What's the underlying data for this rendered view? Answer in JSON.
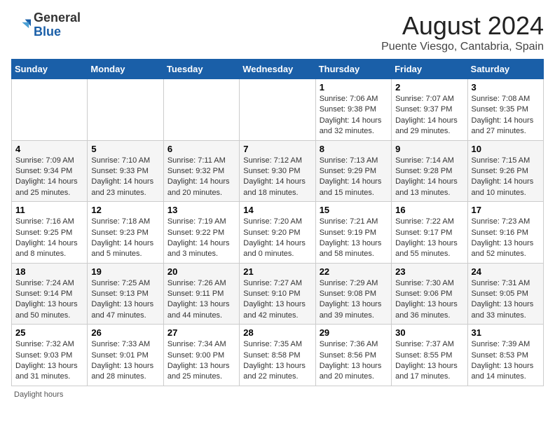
{
  "logo": {
    "general": "General",
    "blue": "Blue"
  },
  "header": {
    "title": "August 2024",
    "subtitle": "Puente Viesgo, Cantabria, Spain"
  },
  "weekdays": [
    "Sunday",
    "Monday",
    "Tuesday",
    "Wednesday",
    "Thursday",
    "Friday",
    "Saturday"
  ],
  "weeks": [
    [
      {
        "day": "",
        "info": ""
      },
      {
        "day": "",
        "info": ""
      },
      {
        "day": "",
        "info": ""
      },
      {
        "day": "",
        "info": ""
      },
      {
        "day": "1",
        "info": "Sunrise: 7:06 AM\nSunset: 9:38 PM\nDaylight: 14 hours and 32 minutes."
      },
      {
        "day": "2",
        "info": "Sunrise: 7:07 AM\nSunset: 9:37 PM\nDaylight: 14 hours and 29 minutes."
      },
      {
        "day": "3",
        "info": "Sunrise: 7:08 AM\nSunset: 9:35 PM\nDaylight: 14 hours and 27 minutes."
      }
    ],
    [
      {
        "day": "4",
        "info": "Sunrise: 7:09 AM\nSunset: 9:34 PM\nDaylight: 14 hours and 25 minutes."
      },
      {
        "day": "5",
        "info": "Sunrise: 7:10 AM\nSunset: 9:33 PM\nDaylight: 14 hours and 23 minutes."
      },
      {
        "day": "6",
        "info": "Sunrise: 7:11 AM\nSunset: 9:32 PM\nDaylight: 14 hours and 20 minutes."
      },
      {
        "day": "7",
        "info": "Sunrise: 7:12 AM\nSunset: 9:30 PM\nDaylight: 14 hours and 18 minutes."
      },
      {
        "day": "8",
        "info": "Sunrise: 7:13 AM\nSunset: 9:29 PM\nDaylight: 14 hours and 15 minutes."
      },
      {
        "day": "9",
        "info": "Sunrise: 7:14 AM\nSunset: 9:28 PM\nDaylight: 14 hours and 13 minutes."
      },
      {
        "day": "10",
        "info": "Sunrise: 7:15 AM\nSunset: 9:26 PM\nDaylight: 14 hours and 10 minutes."
      }
    ],
    [
      {
        "day": "11",
        "info": "Sunrise: 7:16 AM\nSunset: 9:25 PM\nDaylight: 14 hours and 8 minutes."
      },
      {
        "day": "12",
        "info": "Sunrise: 7:18 AM\nSunset: 9:23 PM\nDaylight: 14 hours and 5 minutes."
      },
      {
        "day": "13",
        "info": "Sunrise: 7:19 AM\nSunset: 9:22 PM\nDaylight: 14 hours and 3 minutes."
      },
      {
        "day": "14",
        "info": "Sunrise: 7:20 AM\nSunset: 9:20 PM\nDaylight: 14 hours and 0 minutes."
      },
      {
        "day": "15",
        "info": "Sunrise: 7:21 AM\nSunset: 9:19 PM\nDaylight: 13 hours and 58 minutes."
      },
      {
        "day": "16",
        "info": "Sunrise: 7:22 AM\nSunset: 9:17 PM\nDaylight: 13 hours and 55 minutes."
      },
      {
        "day": "17",
        "info": "Sunrise: 7:23 AM\nSunset: 9:16 PM\nDaylight: 13 hours and 52 minutes."
      }
    ],
    [
      {
        "day": "18",
        "info": "Sunrise: 7:24 AM\nSunset: 9:14 PM\nDaylight: 13 hours and 50 minutes."
      },
      {
        "day": "19",
        "info": "Sunrise: 7:25 AM\nSunset: 9:13 PM\nDaylight: 13 hours and 47 minutes."
      },
      {
        "day": "20",
        "info": "Sunrise: 7:26 AM\nSunset: 9:11 PM\nDaylight: 13 hours and 44 minutes."
      },
      {
        "day": "21",
        "info": "Sunrise: 7:27 AM\nSunset: 9:10 PM\nDaylight: 13 hours and 42 minutes."
      },
      {
        "day": "22",
        "info": "Sunrise: 7:29 AM\nSunset: 9:08 PM\nDaylight: 13 hours and 39 minutes."
      },
      {
        "day": "23",
        "info": "Sunrise: 7:30 AM\nSunset: 9:06 PM\nDaylight: 13 hours and 36 minutes."
      },
      {
        "day": "24",
        "info": "Sunrise: 7:31 AM\nSunset: 9:05 PM\nDaylight: 13 hours and 33 minutes."
      }
    ],
    [
      {
        "day": "25",
        "info": "Sunrise: 7:32 AM\nSunset: 9:03 PM\nDaylight: 13 hours and 31 minutes."
      },
      {
        "day": "26",
        "info": "Sunrise: 7:33 AM\nSunset: 9:01 PM\nDaylight: 13 hours and 28 minutes."
      },
      {
        "day": "27",
        "info": "Sunrise: 7:34 AM\nSunset: 9:00 PM\nDaylight: 13 hours and 25 minutes."
      },
      {
        "day": "28",
        "info": "Sunrise: 7:35 AM\nSunset: 8:58 PM\nDaylight: 13 hours and 22 minutes."
      },
      {
        "day": "29",
        "info": "Sunrise: 7:36 AM\nSunset: 8:56 PM\nDaylight: 13 hours and 20 minutes."
      },
      {
        "day": "30",
        "info": "Sunrise: 7:37 AM\nSunset: 8:55 PM\nDaylight: 13 hours and 17 minutes."
      },
      {
        "day": "31",
        "info": "Sunrise: 7:39 AM\nSunset: 8:53 PM\nDaylight: 13 hours and 14 minutes."
      }
    ]
  ],
  "footer": {
    "daylight_label": "Daylight hours"
  },
  "colors": {
    "header_bg": "#1a5fa8",
    "accent": "#1a5fa8"
  }
}
